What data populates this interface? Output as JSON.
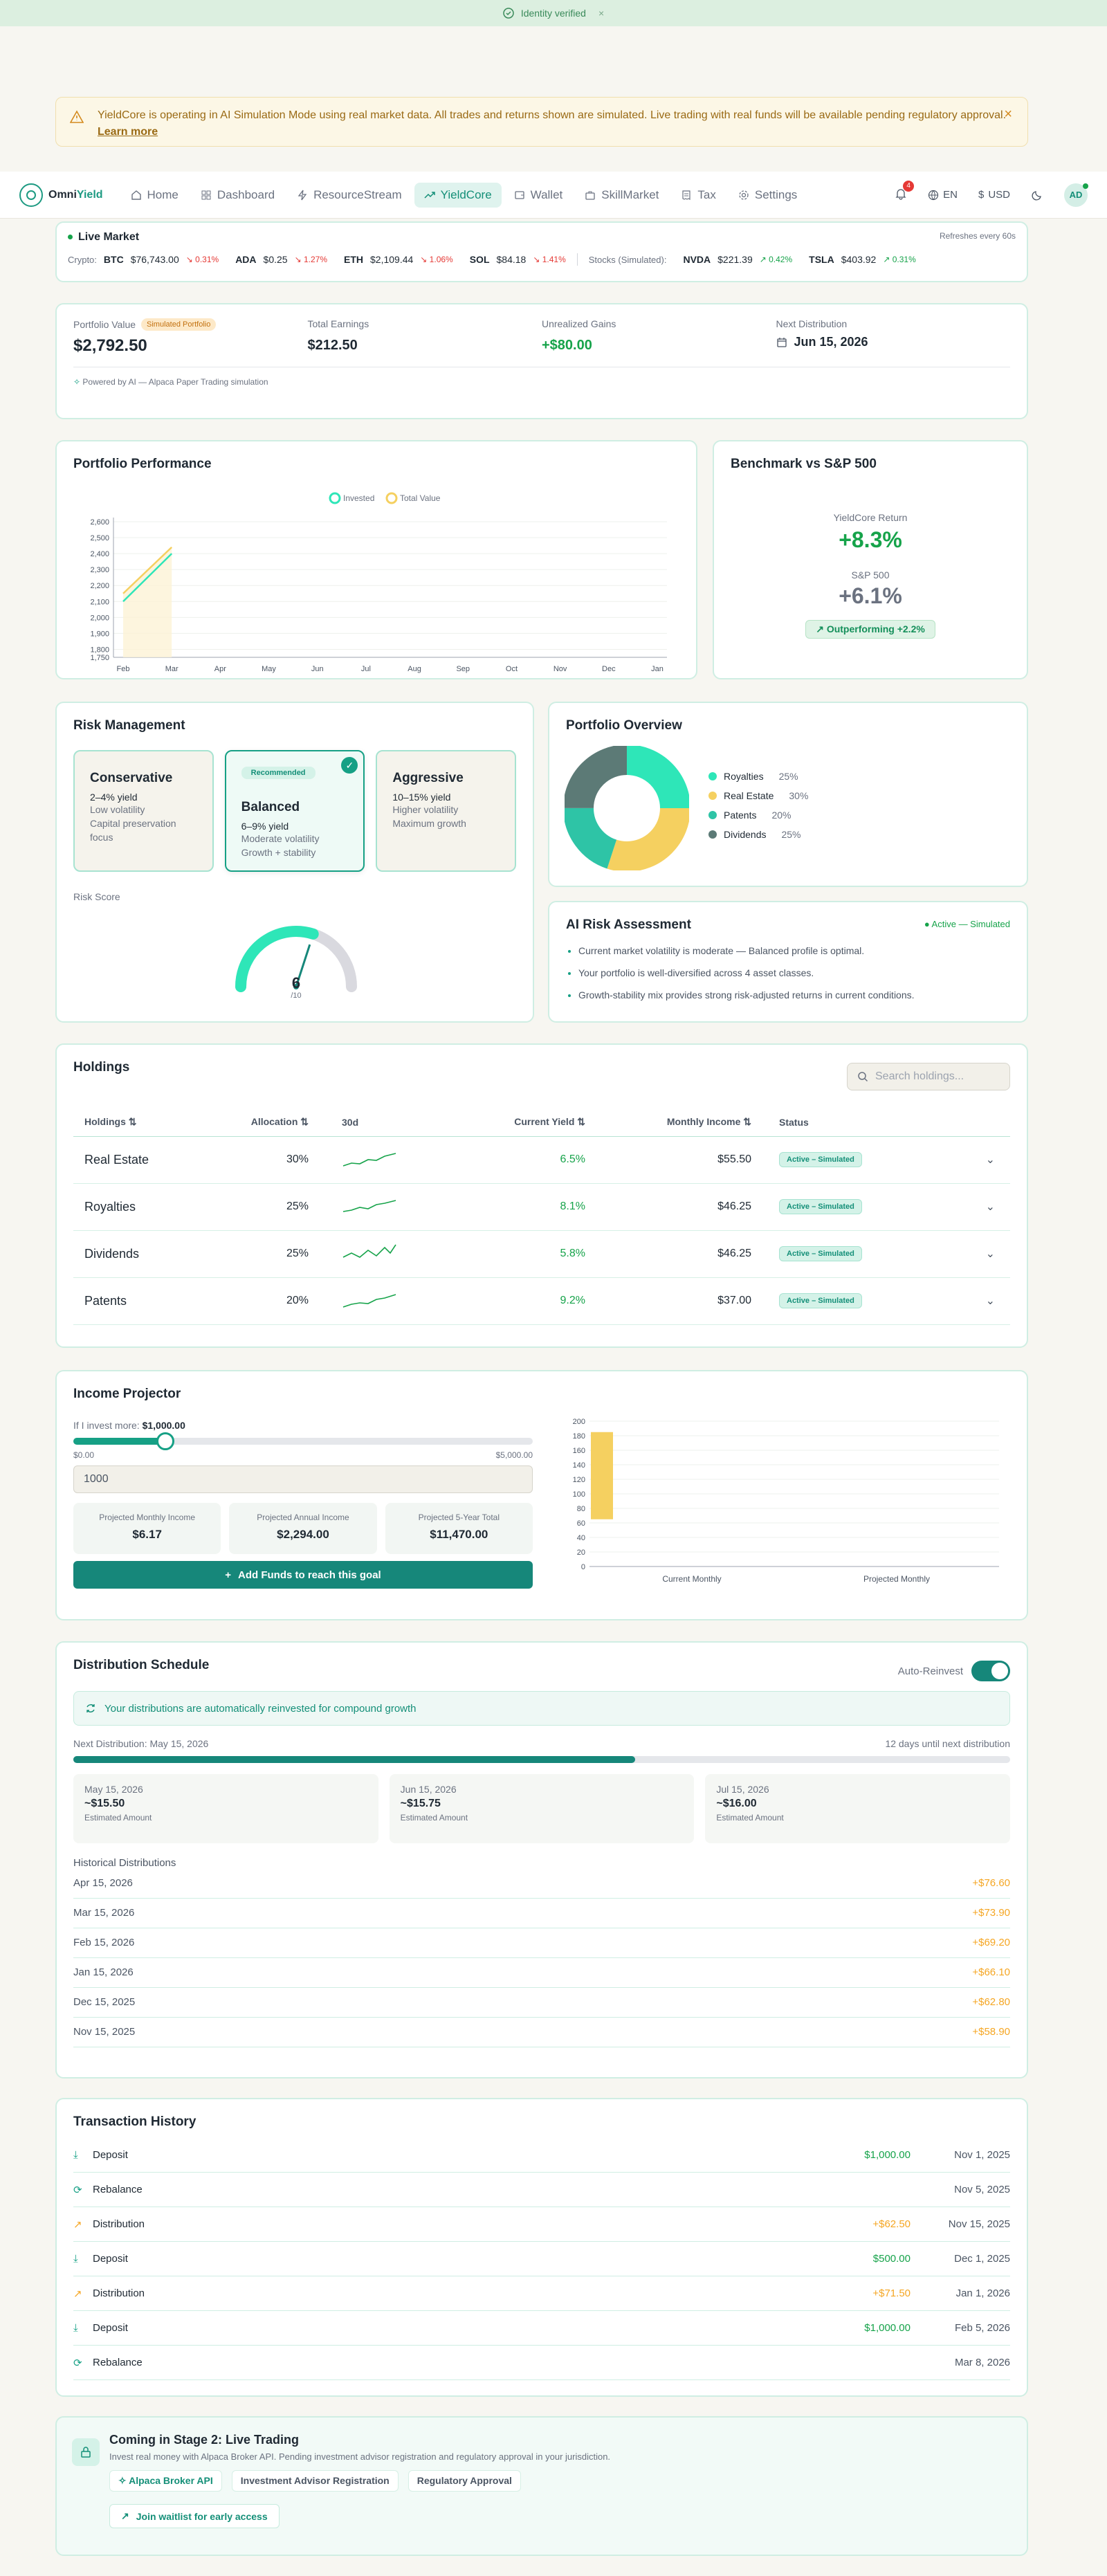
{
  "banner": {
    "verified": "Identity verified",
    "close": "×"
  },
  "sim_alert": {
    "text": "YieldCore is operating in AI Simulation Mode using real market data. All trades and returns shown are simulated. Live trading with real funds will be available pending regulatory approval.",
    "link": "Learn more",
    "close": "×"
  },
  "nav": {
    "logo_a": "Omni",
    "logo_b": "Yield",
    "items": [
      {
        "label": "Home",
        "icon": "home-icon"
      },
      {
        "label": "Dashboard",
        "icon": "dashboard-icon"
      },
      {
        "label": "ResourceStream",
        "icon": "bolt-icon"
      },
      {
        "label": "YieldCore",
        "icon": "trending-up-icon"
      },
      {
        "label": "Wallet",
        "icon": "wallet-icon"
      },
      {
        "label": "SkillMarket",
        "icon": "briefcase-icon"
      },
      {
        "label": "Tax",
        "icon": "receipt-icon"
      },
      {
        "label": "Settings",
        "icon": "gear-icon"
      }
    ],
    "notifications": "4",
    "lang": "EN",
    "currency": "USD",
    "avatar": "AD"
  },
  "ticker": {
    "title": "Live Market",
    "refresh": "Refreshes every 60s",
    "crypto_label": "Crypto:",
    "crypto": [
      {
        "sym": "BTC",
        "price": "$76,743.00",
        "chg": "↘ 0.31%"
      },
      {
        "sym": "ADA",
        "price": "$0.25",
        "chg": "↘ 1.27%"
      },
      {
        "sym": "ETH",
        "price": "$2,109.44",
        "chg": "↘ 1.06%"
      },
      {
        "sym": "SOL",
        "price": "$84.18",
        "chg": "↘ 1.41%"
      }
    ],
    "stocks_label": "Stocks (Simulated):",
    "stocks": [
      {
        "sym": "NVDA",
        "price": "$221.39",
        "chg": "↗ 0.42%"
      },
      {
        "sym": "TSLA",
        "price": "$403.92",
        "chg": "↗ 0.31%"
      }
    ]
  },
  "summary": {
    "portfolio_label": "Portfolio Value",
    "sim_badge": "Simulated Portfolio",
    "portfolio_value": "$2,792.50",
    "earnings_label": "Total Earnings",
    "earnings_value": "$212.50",
    "gains_label": "Unrealized Gains",
    "gains_value": "+$80.00",
    "next_label": "Next Distribution",
    "next_value": "Jun 15, 2026",
    "powered": "Powered by AI — Alpaca Paper Trading simulation"
  },
  "performance": {
    "title": "Portfolio Performance"
  },
  "chart_data": {
    "type": "line",
    "title": "Portfolio Performance",
    "categories": [
      "Feb",
      "Mar",
      "Apr",
      "May",
      "Jun",
      "Jul",
      "Aug",
      "Sep",
      "Oct",
      "Nov",
      "Dec",
      "Jan"
    ],
    "y_ticks": [
      "2,600",
      "2,500",
      "2,400",
      "2,300",
      "2,200",
      "2,100",
      "2,000",
      "1,900",
      "1,800",
      "1,750"
    ],
    "ylim": [
      1750,
      2600
    ],
    "legend": "top-center",
    "series": [
      {
        "name": "Invested",
        "color": "#2ee6b8",
        "values": [
          2100,
          2400
        ]
      },
      {
        "name": "Total Value",
        "color": "#f5d060",
        "values": [
          2150,
          2440
        ]
      }
    ]
  },
  "benchmark": {
    "title": "Benchmark vs S&P 500",
    "yc_label": "YieldCore Return",
    "yc_value": "+8.3%",
    "sp_label": "S&P 500",
    "sp_value": "+6.1%",
    "out": "Outperforming +2.2%"
  },
  "risk": {
    "title": "Risk Management",
    "options": [
      {
        "name": "Conservative",
        "yield": "2–4% yield",
        "d1": "Low volatility",
        "d2": "Capital preservation focus"
      },
      {
        "name": "Balanced",
        "yield": "6–9% yield",
        "d1": "Moderate volatility",
        "d2": "Growth + stability",
        "tag": "Recommended"
      },
      {
        "name": "Aggressive",
        "yield": "10–15% yield",
        "d1": "Higher volatility",
        "d2": "Maximum growth"
      }
    ],
    "score_label": "Risk Score",
    "score": "6",
    "score_max": "/10",
    "score_value": 6
  },
  "overview": {
    "title": "Portfolio Overview",
    "slices": [
      {
        "name": "Royalties",
        "pct": "25%",
        "value": 25,
        "color": "#2ee6b8"
      },
      {
        "name": "Real Estate",
        "pct": "30%",
        "value": 30,
        "color": "#f5d060"
      },
      {
        "name": "Patents",
        "pct": "20%",
        "value": 20,
        "color": "#2ec4a6"
      },
      {
        "name": "Dividends",
        "pct": "25%",
        "value": 25,
        "color": "#5c7a76"
      }
    ]
  },
  "ai": {
    "title": "AI Risk Assessment",
    "badge": "● Active — Simulated",
    "points": [
      "Current market volatility is moderate — Balanced profile is optimal.",
      "Your portfolio is well-diversified across 4 asset classes.",
      "Growth-stability mix provides strong risk-adjusted returns in current conditions."
    ]
  },
  "holdings": {
    "title": "Holdings",
    "search_placeholder": "Search holdings...",
    "headers": {
      "name": "Holdings ⇅",
      "alloc": "Allocation ⇅",
      "trend": "30d",
      "yield": "Current Yield ⇅",
      "income": "Monthly Income ⇅",
      "status": "Status"
    },
    "rows": [
      {
        "name": "Real Estate",
        "alloc": "30%",
        "yield": "6.5%",
        "income": "$55.50",
        "status": "Active – Simulated"
      },
      {
        "name": "Royalties",
        "alloc": "25%",
        "yield": "8.1%",
        "income": "$46.25",
        "status": "Active – Simulated"
      },
      {
        "name": "Dividends",
        "alloc": "25%",
        "yield": "5.8%",
        "income": "$46.25",
        "status": "Active – Simulated"
      },
      {
        "name": "Patents",
        "alloc": "20%",
        "yield": "9.2%",
        "income": "$37.00",
        "status": "Active – Simulated"
      }
    ]
  },
  "projector": {
    "title": "Income Projector",
    "invest_label": "If I invest more:",
    "invest_value": "$1,000.00",
    "min": "$0.00",
    "max": "$5,000.00",
    "input_value": "1000",
    "slider_fraction": 0.2,
    "cards": [
      {
        "label": "Projected Monthly Income",
        "value": "$6.17"
      },
      {
        "label": "Projected Annual Income",
        "value": "$2,294.00"
      },
      {
        "label": "Projected 5-Year Total",
        "value": "$11,470.00"
      }
    ],
    "button": "Add Funds to reach this goal",
    "bar_chart": {
      "categories": [
        "Current Monthly",
        "Projected Monthly"
      ],
      "y_ticks": [
        "200",
        "180",
        "160",
        "140",
        "120",
        "100",
        "80",
        "60",
        "40",
        "20",
        "0"
      ],
      "bar_from": 65,
      "bar_to": 185
    }
  },
  "distribution": {
    "title": "Distribution Schedule",
    "auto": "Auto-Reinvest",
    "info": "Your distributions are automatically reinvested for compound growth",
    "next": "Next Distribution: May 15, 2026",
    "until": "12 days until next distribution",
    "progress": 0.6,
    "upcoming": [
      {
        "date": "May 15, 2026",
        "amt": "~$15.50",
        "lbl": "Estimated Amount"
      },
      {
        "date": "Jun 15, 2026",
        "amt": "~$15.75",
        "lbl": "Estimated Amount"
      },
      {
        "date": "Jul 15, 2026",
        "amt": "~$16.00",
        "lbl": "Estimated Amount"
      }
    ],
    "hist_title": "Historical Distributions",
    "history": [
      {
        "date": "Apr 15, 2026",
        "amt": "+$76.60"
      },
      {
        "date": "Mar 15, 2026",
        "amt": "+$73.90"
      },
      {
        "date": "Feb 15, 2026",
        "amt": "+$69.20"
      },
      {
        "date": "Jan 15, 2026",
        "amt": "+$66.10"
      },
      {
        "date": "Dec 15, 2025",
        "amt": "+$62.80"
      },
      {
        "date": "Nov 15, 2025",
        "amt": "+$58.90"
      }
    ]
  },
  "transactions": {
    "title": "Transaction History",
    "rows": [
      {
        "type": "Deposit",
        "amt": "$1,000.00",
        "date": "Nov 1, 2025",
        "kind": "dep"
      },
      {
        "type": "Rebalance",
        "amt": "",
        "date": "Nov 5, 2025",
        "kind": "reb"
      },
      {
        "type": "Distribution",
        "amt": "+$62.50",
        "date": "Nov 15, 2025",
        "kind": "dist"
      },
      {
        "type": "Deposit",
        "amt": "$500.00",
        "date": "Dec 1, 2025",
        "kind": "dep"
      },
      {
        "type": "Distribution",
        "amt": "+$71.50",
        "date": "Jan 1, 2026",
        "kind": "dist"
      },
      {
        "type": "Deposit",
        "amt": "$1,000.00",
        "date": "Feb 5, 2026",
        "kind": "dep"
      },
      {
        "type": "Rebalance",
        "amt": "",
        "date": "Mar 8, 2026",
        "kind": "reb"
      }
    ]
  },
  "stage": {
    "title": "Coming in Stage 2: Live Trading",
    "desc": "Invest real money with Alpaca Broker API. Pending investment advisor registration and regulatory approval in your jurisdiction.",
    "tags": [
      "Alpaca Broker API",
      "Investment Advisor Registration",
      "Regulatory Approval"
    ],
    "button": "Join waitlist for early access"
  }
}
